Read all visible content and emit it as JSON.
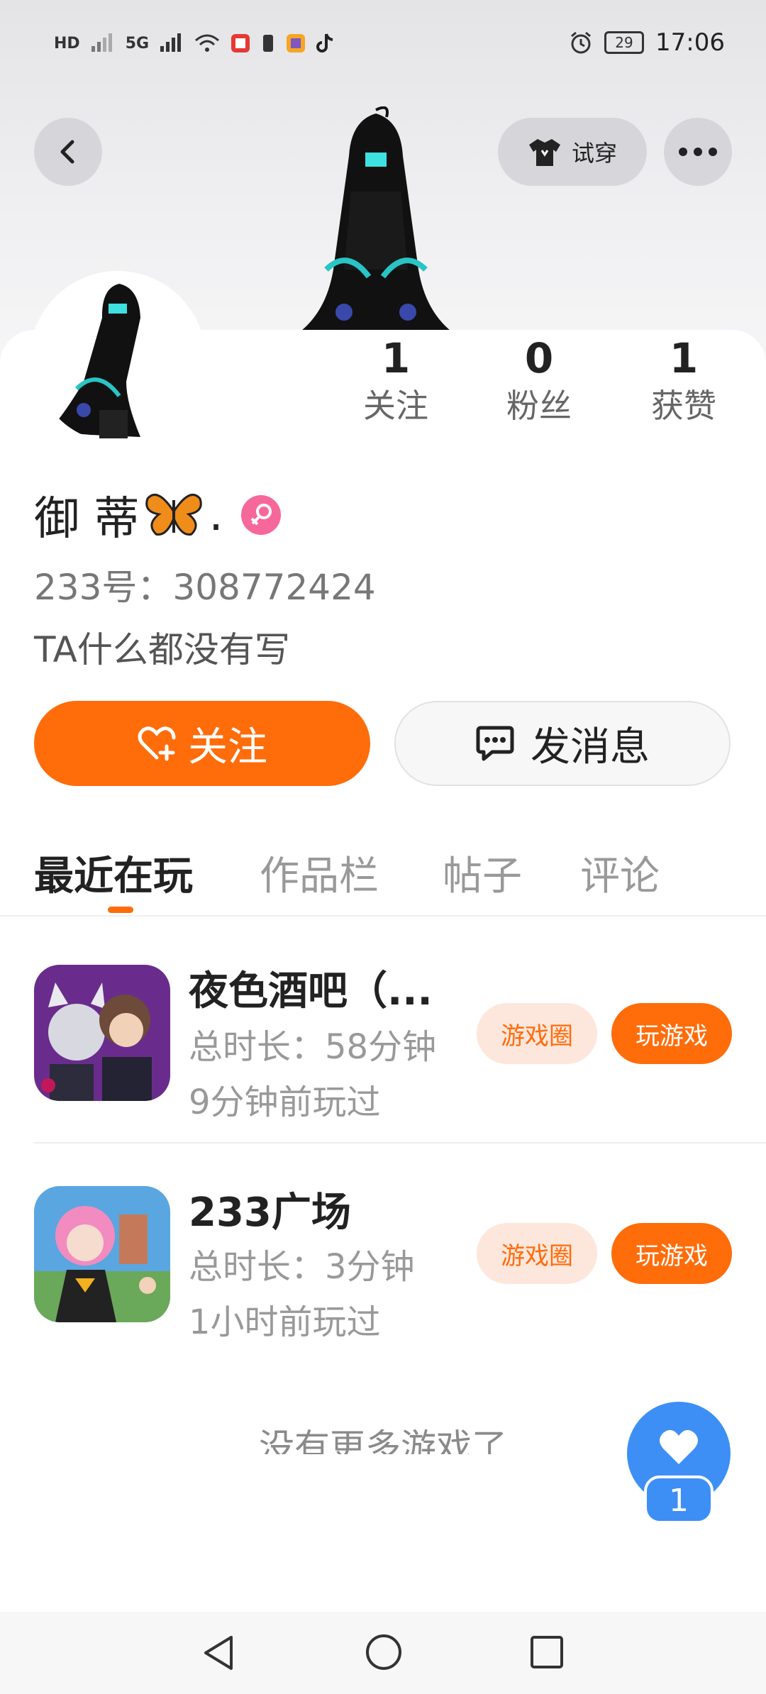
{
  "status_bar": {
    "network_labels": [
      "HD",
      "5G"
    ],
    "battery": "29",
    "time": "17:06"
  },
  "header": {
    "try_on_label": "试穿"
  },
  "profile": {
    "stats": [
      {
        "value": "1",
        "label": "关注"
      },
      {
        "value": "0",
        "label": "粉丝"
      },
      {
        "value": "1",
        "label": "获赞"
      }
    ],
    "name": "御 蒂",
    "name_suffix": ".",
    "id_text": "233号：308772424",
    "bio": "TA什么都没有写",
    "follow_label": "关注",
    "message_label": "发消息"
  },
  "tabs": [
    {
      "label": "最近在玩",
      "active": true
    },
    {
      "label": "作品栏",
      "active": false
    },
    {
      "label": "帖子",
      "active": false
    },
    {
      "label": "评论",
      "active": false
    }
  ],
  "games": [
    {
      "title": "夜色酒吧（...",
      "duration": "总时长：58分钟",
      "last_played": "9分钟前玩过",
      "circle_label": "游戏圈",
      "play_label": "玩游戏"
    },
    {
      "title": "233广场",
      "duration": "总时长：3分钟",
      "last_played": "1小时前玩过",
      "circle_label": "游戏圈",
      "play_label": "玩游戏"
    }
  ],
  "footer_text": "没有更多游戏了",
  "like_badge": "1",
  "colors": {
    "accent": "#ff6c0a",
    "like_blue": "#3d8ff5"
  }
}
